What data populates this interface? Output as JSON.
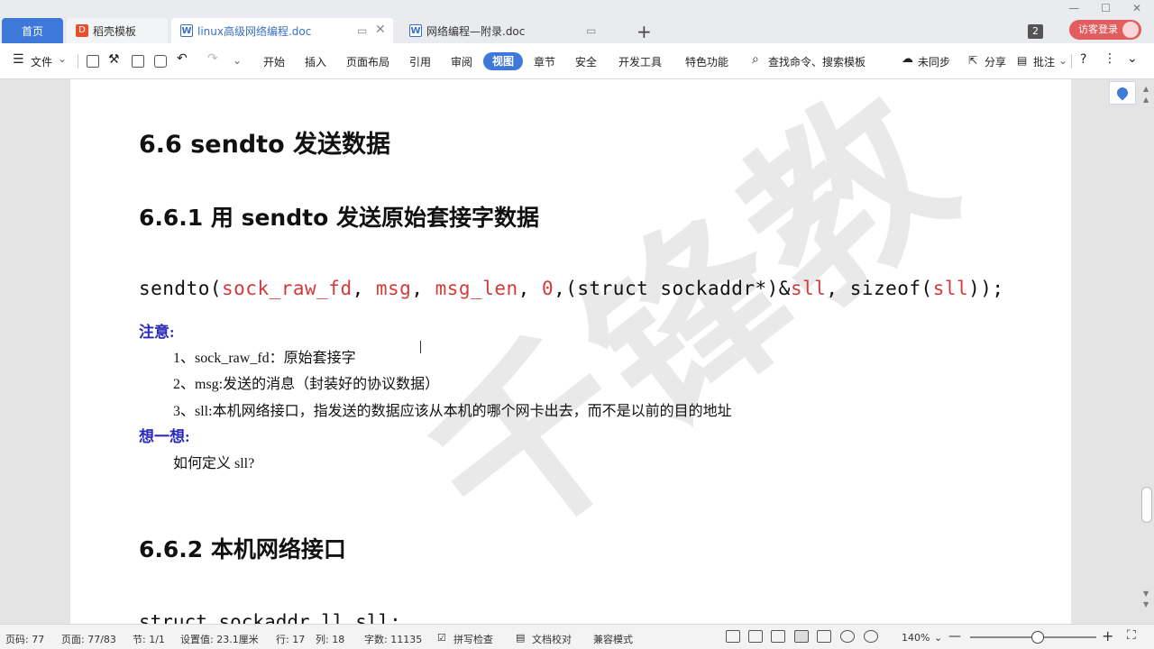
{
  "tabs": {
    "home": "首页",
    "template": "稻壳模板",
    "doc1": "linux高级网络编程.doc",
    "doc2": "网络编程—附录.doc",
    "new": "+",
    "count": "2",
    "login": "访客登录"
  },
  "ribbon": {
    "file": "文件",
    "items": [
      "开始",
      "插入",
      "页面布局",
      "引用",
      "审阅",
      "视图",
      "章节",
      "安全",
      "开发工具",
      "特色功能"
    ],
    "active": "视图",
    "search": "查找命令、搜索模板",
    "sync": "未同步",
    "share": "分享",
    "comment": "批注"
  },
  "doc": {
    "h1": "6.6 sendto 发送数据",
    "h2a": "6.6.1 用 sendto 发送原始套接字数据",
    "code": {
      "fn": "sendto(",
      "a1": "sock_raw_fd",
      "c1": ", ",
      "a2": "msg",
      "c2": ", ",
      "a3": "msg_len",
      "c3": ", ",
      "a4": "0",
      "c4": ",(struct sockaddr*)&",
      "a5": "sll",
      "c5": ", sizeof(",
      "a6": "sll",
      "end": "));"
    },
    "note_label": "注意:",
    "notes": [
      "1、sock_raw_fd：原始套接字",
      "2、msg:发送的消息（封装好的协议数据）",
      "3、sll:本机网络接口，指发送的数据应该从本机的哪个网卡出去，而不是以前的目的地址"
    ],
    "think_label": "想一想:",
    "think_item": "如何定义 sll?",
    "h2b": "6.6.2 本机网络接口",
    "code_bottom": "struct sockaddr_ll sll;"
  },
  "status": {
    "page_code": "页码: 77",
    "page": "页面: 77/83",
    "section": "节: 1/1",
    "setting": "设置值: 23.1厘米",
    "row": "行: 17",
    "col": "列: 18",
    "words": "字数: 11135",
    "spell": "拼写检查",
    "proof": "文档校对",
    "compat": "兼容模式",
    "zoom": "140%"
  }
}
